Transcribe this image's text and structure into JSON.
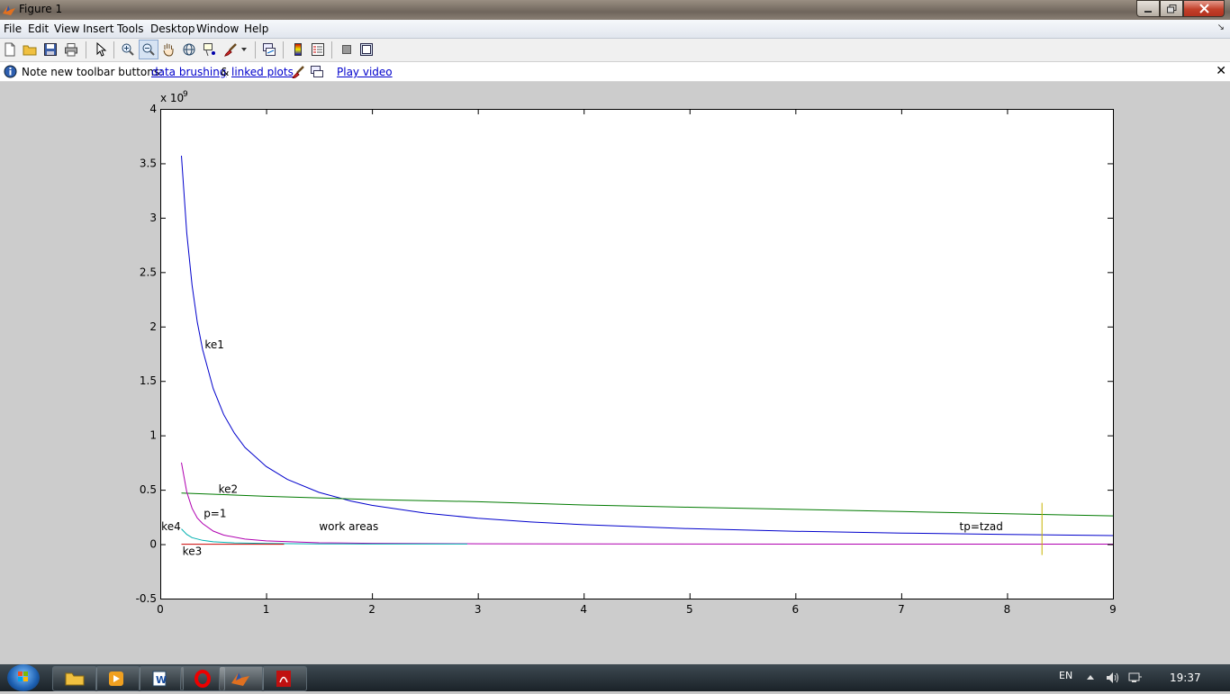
{
  "window": {
    "title": "Figure 1"
  },
  "menu": [
    "File",
    "Edit",
    "View",
    "Insert",
    "Tools",
    "Desktop",
    "Window",
    "Help"
  ],
  "toolbar": {
    "buttons": [
      "new-figure",
      "open-file",
      "save-figure",
      "print-figure",
      "edit-plot",
      "zoom-in",
      "zoom-out",
      "pan",
      "rotate-3d",
      "data-cursor",
      "brush",
      "link-plot",
      "hide-plot-tools",
      "show-plot-tools"
    ]
  },
  "notice": {
    "prefix": "Note new toolbar buttons:",
    "link1": "data brushing",
    "amp": "&",
    "link2": "linked plots",
    "link3": "Play video"
  },
  "taskbar": {
    "language": "EN",
    "time": "19:37"
  },
  "chart_data": {
    "type": "line",
    "title": "",
    "xlabel": "",
    "ylabel": "",
    "y_exponent_label": "x 10",
    "y_exponent": "9",
    "xlim": [
      0,
      9
    ],
    "ylim": [
      -0.5,
      4
    ],
    "xticks": [
      0,
      1,
      2,
      3,
      4,
      5,
      6,
      7,
      8,
      9
    ],
    "yticks": [
      -0.5,
      0,
      0.5,
      1,
      1.5,
      2,
      2.5,
      3,
      3.5,
      4
    ],
    "ytick_labels": [
      "-0.5",
      "0",
      "0.5",
      "1",
      "1.5",
      "2",
      "2.5",
      "3",
      "3.5",
      "4"
    ],
    "grid": false,
    "series": [
      {
        "name": "ke1",
        "color": "#0000cc",
        "x": [
          0.2,
          0.25,
          0.3,
          0.35,
          0.4,
          0.5,
          0.6,
          0.7,
          0.8,
          1.0,
          1.2,
          1.5,
          1.8,
          2.0,
          2.5,
          3.0,
          3.5,
          4.0,
          5.0,
          6.0,
          7.0,
          8.0,
          9.0
        ],
        "y": [
          3.57,
          2.86,
          2.38,
          2.04,
          1.79,
          1.43,
          1.19,
          1.02,
          0.89,
          0.714,
          0.595,
          0.476,
          0.397,
          0.357,
          0.286,
          0.238,
          0.204,
          0.179,
          0.143,
          0.119,
          0.102,
          0.089,
          0.079
        ]
      },
      {
        "name": "ke2",
        "color": "#007a00",
        "x": [
          0.2,
          1,
          2,
          3,
          4,
          5,
          6,
          7,
          8,
          9
        ],
        "y": [
          0.47,
          0.44,
          0.41,
          0.39,
          0.36,
          0.34,
          0.32,
          0.3,
          0.28,
          0.26
        ]
      },
      {
        "name": "p=1",
        "color": "#b000b0",
        "x": [
          0.2,
          0.25,
          0.3,
          0.35,
          0.4,
          0.5,
          0.6,
          0.8,
          1.0,
          1.5,
          2,
          3,
          4,
          5,
          6,
          7,
          8,
          9
        ],
        "y": [
          0.75,
          0.48,
          0.33,
          0.24,
          0.19,
          0.12,
          0.083,
          0.047,
          0.03,
          0.013,
          0.008,
          0.004,
          0.002,
          0.0012,
          0.0008,
          0.0006,
          0.0005,
          0.0004
        ]
      },
      {
        "name": "ke4",
        "color": "#00b0b0",
        "x": [
          0.2,
          0.25,
          0.3,
          0.4,
          0.5,
          0.7,
          1.0,
          1.5,
          2.0,
          2.9
        ],
        "y": [
          0.14,
          0.09,
          0.06,
          0.035,
          0.022,
          0.012,
          0.006,
          0.003,
          0.0015,
          0.001
        ]
      },
      {
        "name": "ke3",
        "color": "#cc0000",
        "x": [
          0.2,
          0.5,
          1.0,
          1.17
        ],
        "y": [
          0.0,
          0.0,
          0.0,
          0.0
        ]
      },
      {
        "name": "tp=tzad",
        "color": "#c8b400",
        "x": [
          8.33,
          8.33
        ],
        "y": [
          -0.1,
          0.38
        ]
      }
    ],
    "annotations": [
      {
        "text": "ke1",
        "x": 0.42,
        "y": 1.8
      },
      {
        "text": "ke2",
        "x": 0.55,
        "y": 0.47
      },
      {
        "text": "p=1",
        "x": 0.41,
        "y": 0.25
      },
      {
        "text": "ke4",
        "x": 0.01,
        "y": 0.13
      },
      {
        "text": "ke3",
        "x": 0.21,
        "y": -0.1
      },
      {
        "text": "work areas",
        "x": 1.5,
        "y": 0.13
      },
      {
        "text": "tp=tzad",
        "x": 7.55,
        "y": 0.13
      }
    ]
  }
}
